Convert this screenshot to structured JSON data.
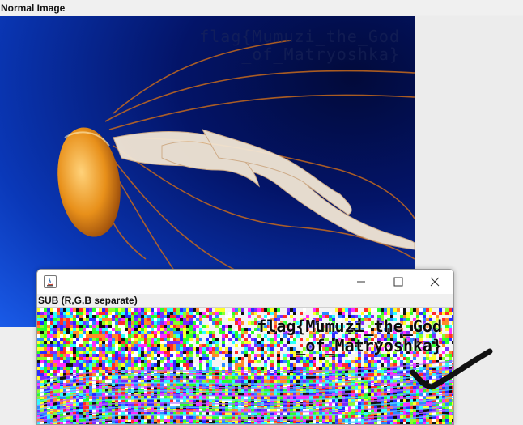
{
  "main_window": {
    "panel_title": "Normal Image",
    "image": {
      "subject": "jellyfish",
      "hidden_text": [
        "flag{Mumuzi_the_God",
        "_of_Matryoshka}"
      ]
    }
  },
  "sub_window": {
    "icon": "java-icon",
    "controls": [
      "minimize-icon",
      "maximize-icon",
      "close-icon"
    ],
    "panel_label": "SUB (R,G,B separate)",
    "revealed_text": [
      "flag{Mumuzi_the_God",
      "_of_Matryoshka}"
    ]
  },
  "annotation": {
    "mark": "checkmark",
    "color": "#111111"
  },
  "colors": {
    "background": "#ececec",
    "ocean_deep": "#031468",
    "ocean_light": "#1a5be8",
    "jellyfish_bell": "#e8901a"
  }
}
